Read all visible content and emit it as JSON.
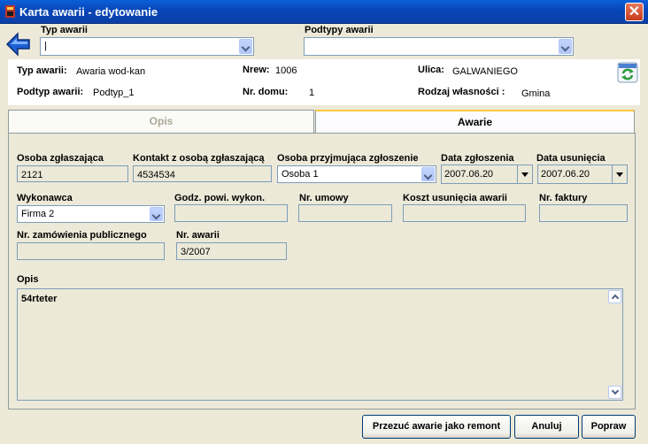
{
  "window": {
    "title": "Karta awarii - edytowanie",
    "close_glyph": "✕"
  },
  "top": {
    "typ_awarii_label": "Typ awarii",
    "typ_awarii_value": "|",
    "podtypy_label": "Podtypy awarii",
    "podtypy_value": ""
  },
  "info": {
    "typ_label": "Typ awarii:",
    "typ_value": "Awaria wod-kan",
    "nrew_label": "Nrew:",
    "nrew_value": "1006",
    "ulica_label": "Ulica:",
    "ulica_value": "GALWANIEGO",
    "podtyp_label": "Podtyp awarii:",
    "podtyp_value": "Podtyp_1",
    "nrdomu_label": "Nr. domu:",
    "nrdomu_value": "1",
    "rodzaj_label": "Rodzaj własności :",
    "rodzaj_value": "Gmina"
  },
  "tabs": {
    "opis": "Opis",
    "awarie": "Awarie"
  },
  "form": {
    "osoba_zgl_label": "Osoba zgłaszająca",
    "osoba_zgl_value": "2121",
    "kontakt_label": "Kontakt z osobą zgłaszającą",
    "kontakt_value": "4534534",
    "osoba_przyj_label": "Osoba przyjmująca zgłoszenie",
    "osoba_przyj_value": "Osoba 1",
    "data_zgl_label": "Data zgłoszenia",
    "data_zgl_value": "2007.06.20",
    "data_usun_label": "Data usunięcia",
    "data_usun_value": "2007.06.20",
    "wykonawca_label": "Wykonawca",
    "wykonawca_value": "Firma 2",
    "godz_label": "Godz. powi. wykon.",
    "godz_value": "",
    "nr_umowy_label": "Nr. umowy",
    "nr_umowy_value": "",
    "koszt_label": "Koszt usunięcia awarii",
    "koszt_value": "",
    "nr_faktury_label": "Nr. faktury",
    "nr_faktury_value": "",
    "nr_zam_label": "Nr. zamówienia  publicznego",
    "nr_zam_value": "",
    "nr_awarii_label": "Nr. awarii",
    "nr_awarii_value": "3/2007",
    "opis_label": "Opis",
    "opis_value": "54rteter"
  },
  "buttons": {
    "przeksztalc": "Przezuć awarie jako remont",
    "anuluj": "Anuluj",
    "popraw": "Popraw"
  },
  "colors": {
    "titlebar": "#0a5fd8",
    "tab_highlight": "#ffc83c",
    "back_arrow": "#1c5fd2",
    "refresh": "#2d9a3b"
  }
}
